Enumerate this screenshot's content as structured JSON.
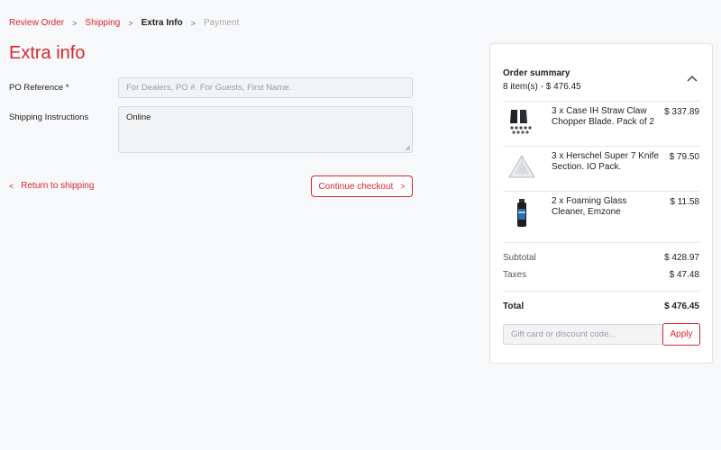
{
  "breadcrumb": {
    "items": [
      {
        "label": "Review Order"
      },
      {
        "label": "Shipping"
      },
      {
        "label": "Extra Info"
      },
      {
        "label": "Payment"
      }
    ]
  },
  "page": {
    "title": "Extra info"
  },
  "form": {
    "po_reference": {
      "label": "PO Reference *",
      "placeholder": "For Dealers, PO #. For Guests, First Name.",
      "value": ""
    },
    "shipping_instructions": {
      "label": "Shipping Instructions",
      "value": "Online"
    }
  },
  "actions": {
    "return_label": "Return to shipping",
    "continue_label": "Continue checkout"
  },
  "summary": {
    "title": "Order summary",
    "subtitle": "8 item(s) -  $ 476.45",
    "items": [
      {
        "name": "3 x Case IH Straw Claw Chopper Blade. Pack of 2",
        "price": "$ 337.89",
        "icon": "blade-pack-icon"
      },
      {
        "name": "3 x Herschel Super 7 Knife Section. IO Pack.",
        "price": "$ 79.50",
        "icon": "knife-section-icon"
      },
      {
        "name": "2 x Foaming Glass Cleaner, Emzone",
        "price": "$ 11.58",
        "icon": "spray-can-icon"
      }
    ],
    "subtotal": {
      "label": "Subtotal",
      "value": "$ 428.97"
    },
    "taxes": {
      "label": "Taxes",
      "value": "$ 47.48"
    },
    "total": {
      "label": "Total",
      "value": "$ 476.45"
    },
    "discount": {
      "placeholder": "Gift card or discount code...",
      "apply_label": "Apply"
    }
  },
  "colors": {
    "accent": "#d9262e",
    "background": "#f7f8fa"
  }
}
